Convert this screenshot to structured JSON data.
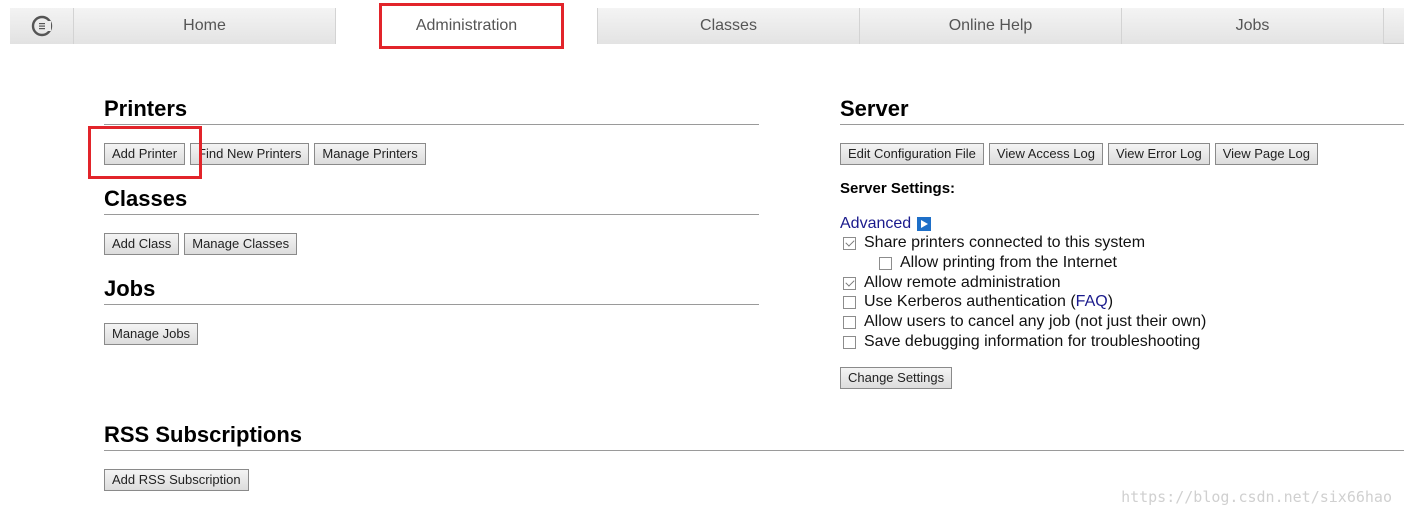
{
  "nav": {
    "tabs": [
      {
        "label": "Home"
      },
      {
        "label": "Administration"
      },
      {
        "label": "Classes"
      },
      {
        "label": "Online Help"
      },
      {
        "label": "Jobs"
      }
    ],
    "active": "Administration"
  },
  "printers": {
    "title": "Printers",
    "buttons": [
      "Add Printer",
      "Find New Printers",
      "Manage Printers"
    ]
  },
  "classes": {
    "title": "Classes",
    "buttons": [
      "Add Class",
      "Manage Classes"
    ]
  },
  "jobs": {
    "title": "Jobs",
    "buttons": [
      "Manage Jobs"
    ]
  },
  "server": {
    "title": "Server",
    "buttons": [
      "Edit Configuration File",
      "View Access Log",
      "View Error Log",
      "View Page Log"
    ],
    "settings_title": "Server Settings:",
    "advanced_label": "Advanced",
    "options": [
      {
        "label": "Share printers connected to this system",
        "checked": true
      },
      {
        "label": "Allow printing from the Internet",
        "checked": false
      },
      {
        "label": "Allow remote administration",
        "checked": true
      },
      {
        "label": "Use Kerberos authentication (",
        "link": "FAQ",
        "suffix": ")",
        "checked": false
      },
      {
        "label": "Allow users to cancel any job (not just their own)",
        "checked": false
      },
      {
        "label": "Save debugging information for troubleshooting",
        "checked": false
      }
    ],
    "change_button": "Change Settings"
  },
  "rss": {
    "title": "RSS Subscriptions",
    "buttons": [
      "Add RSS Subscription"
    ]
  },
  "watermark": "https://blog.csdn.net/six66hao",
  "colors": {
    "highlight": "#e2242a",
    "link": "#1a1a8c"
  }
}
